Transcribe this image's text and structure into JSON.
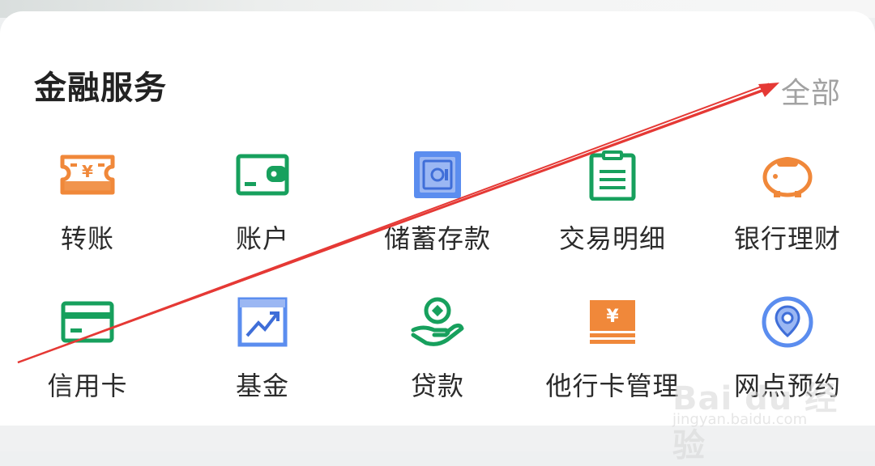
{
  "section": {
    "title": "金融服务",
    "view_all": "全部"
  },
  "items": [
    {
      "label": "转账",
      "icon": "transfer-icon"
    },
    {
      "label": "账户",
      "icon": "wallet-icon"
    },
    {
      "label": "储蓄存款",
      "icon": "safe-icon"
    },
    {
      "label": "交易明细",
      "icon": "clipboard-icon"
    },
    {
      "label": "银行理财",
      "icon": "piggy-bank-icon"
    },
    {
      "label": "信用卡",
      "icon": "credit-card-icon"
    },
    {
      "label": "基金",
      "icon": "fund-chart-icon"
    },
    {
      "label": "贷款",
      "icon": "loan-coin-hand-icon"
    },
    {
      "label": "他行卡管理",
      "icon": "other-bank-card-icon"
    },
    {
      "label": "网点预约",
      "icon": "location-pin-icon"
    }
  ],
  "watermark": {
    "main": "Bai du 经验",
    "sub": "jingyan.baidu.com"
  },
  "colors": {
    "orange": "#F0883A",
    "green": "#17A05D",
    "blue": "#5B8DEF",
    "annotation_red": "#E53935"
  }
}
